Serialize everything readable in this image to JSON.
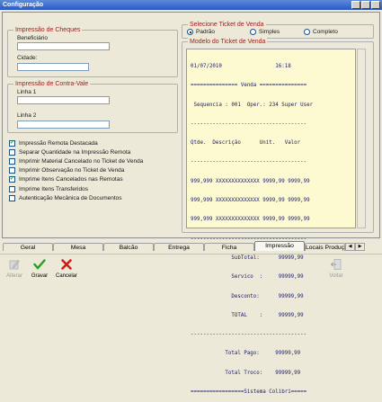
{
  "window": {
    "title": "Configuração"
  },
  "cheques": {
    "legend": "Impressão de Cheques",
    "beneficiario_label": "Beneficiário",
    "beneficiario_value": "",
    "cidade_label": "Cidade:",
    "cidade_value": ""
  },
  "contra_vale": {
    "legend": "Impressão de Contra-Vale",
    "linha1_label": "Linha 1",
    "linha1_value": "",
    "linha2_label": "Linha 2",
    "linha2_value": ""
  },
  "options": [
    {
      "label": "Impressão Remota Destacada",
      "checked": true
    },
    {
      "label": "Separar Quantidade na Impressão Remota",
      "checked": false
    },
    {
      "label": "Imprimir Material Cancelado no Ticket de Venda",
      "checked": false
    },
    {
      "label": "Imprimir Observação no Ticket de Venda",
      "checked": false
    },
    {
      "label": "Imprime Itens Cancelados nas Remotas",
      "checked": true
    },
    {
      "label": "Imprime Itens Transferidos",
      "checked": false
    },
    {
      "label": "Autenticação Mecânica de Documentos",
      "checked": false
    }
  ],
  "ticket_select": {
    "legend": "Selecione Ticket de Venda",
    "options": [
      {
        "label": "Padrão",
        "selected": true
      },
      {
        "label": "Simples",
        "selected": false
      },
      {
        "label": "Completo",
        "selected": false
      }
    ]
  },
  "ticket_model": {
    "legend": "Modelo do Ticket de Venda",
    "lines": [
      "01/07/2010                 16:18",
      "=============== Venda ===============",
      " Sequencia : 001  Oper.: 234 Super User",
      "-------------------------------------",
      "Qtde.  Descrição      Unit.   Valor",
      "-------------------------------------",
      "999,999 XXXXXXXXXXXXXX 9999,99 9999,99",
      "999,999 XXXXXXXXXXXXXX 9999,99 9999,99",
      "999,999 XXXXXXXXXXXXXX 9999,99 9999,99",
      "-------------------------------------",
      "             SubTotal:      99999,99",
      "             Servico  :     99999,99",
      "             Desconto:      99999,99",
      "             TOTAL    :     99999,99",
      "-------------------------------------",
      "           Total Pago:     99999,99",
      "           Total Troco:    99999,99",
      "=================Sistema Colibri====="
    ]
  },
  "tabs": [
    "Geral",
    "Mesa",
    "Balcão",
    "Entrega",
    "Ficha",
    "Impressão",
    "Locais Produç"
  ],
  "active_tab": "Impressão",
  "toolbar": {
    "alterar": "Alterar",
    "gravar": "Gravar",
    "cancelar": "Cancelar",
    "voltar": "Voltar"
  },
  "colors": {
    "legend_text": "#a02020",
    "ticket_bg": "#fdfad2",
    "check_mark": "#21a121",
    "cancel_red": "#d21a1a"
  }
}
